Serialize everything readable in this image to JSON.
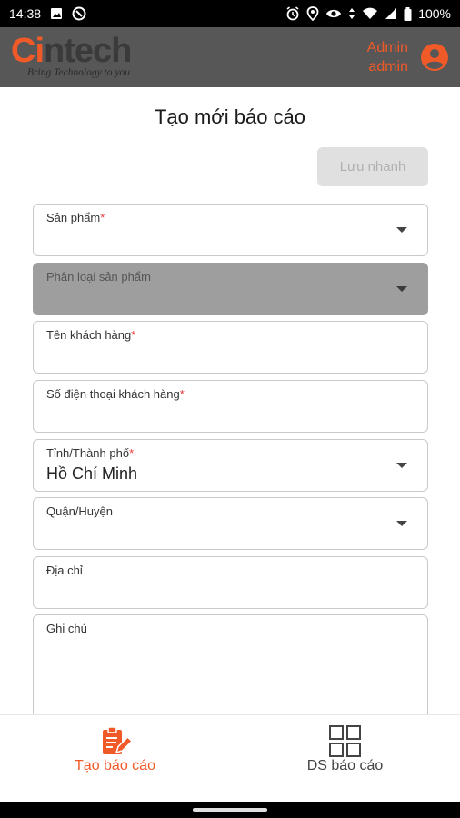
{
  "status_bar": {
    "time": "14:38",
    "battery": "100%"
  },
  "header": {
    "logo_ci": "Ci",
    "logo_ntech": "ntech",
    "tagline": "Bring Technology to you",
    "user_role": "Admin",
    "user_name": "admin"
  },
  "form": {
    "title": "Tạo mới báo cáo",
    "quick_save_label": "Lưu nhanh",
    "fields": [
      {
        "label": "Sản phẩm",
        "required": "*",
        "value": ""
      },
      {
        "label": "Phân loại sản phẩm",
        "required": "",
        "value": ""
      },
      {
        "label": "Tên khách hàng",
        "required": "*",
        "value": ""
      },
      {
        "label": "Số điện thoại khách hàng",
        "required": "*",
        "value": ""
      },
      {
        "label": "Tỉnh/Thành phố",
        "required": "*",
        "value": "Hồ Chí Minh"
      },
      {
        "label": "Quận/Huyện",
        "required": "",
        "value": ""
      },
      {
        "label": "Địa chỉ",
        "required": "",
        "value": ""
      },
      {
        "label": "Ghi chú",
        "required": "",
        "value": ""
      }
    ]
  },
  "bottom_nav": {
    "items": [
      {
        "label": "Tạo báo cáo",
        "icon": "report-edit-icon",
        "active": true
      },
      {
        "label": "DS báo cáo",
        "icon": "grid-list-icon",
        "active": false
      }
    ]
  },
  "colors": {
    "accent": "#f05a28",
    "header_bg": "#575757",
    "disabled_field": "#9e9e9e",
    "required": "#e53935"
  }
}
